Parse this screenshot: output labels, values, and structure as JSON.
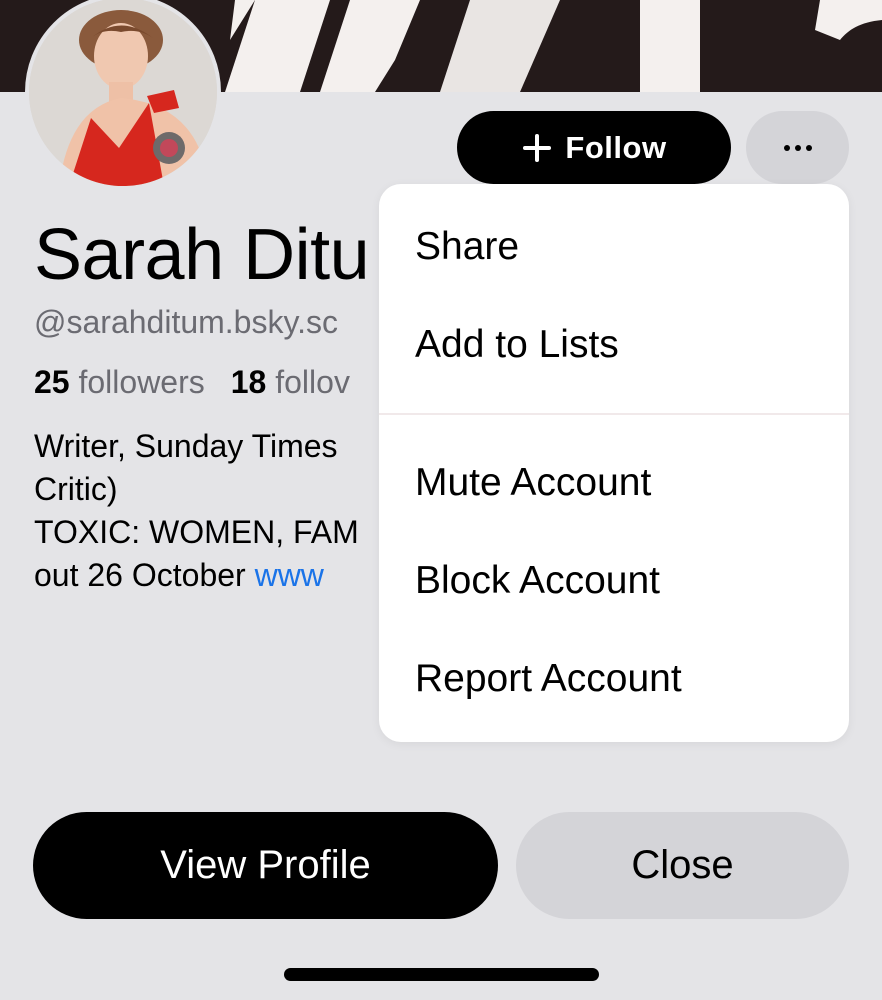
{
  "banner": {
    "image": "book-cover-banner",
    "color": "#241a1a"
  },
  "avatar": {
    "alt": "profile-photo"
  },
  "actions": {
    "follow_label": "Follow",
    "follow_icon": "plus-icon",
    "more_icon": "more-horizontal-icon"
  },
  "profile": {
    "display_name": "Sarah Ditu",
    "handle": "@sarahditum.bsky.sc",
    "followers_count": "25",
    "followers_label": "followers",
    "following_count": "18",
    "following_label": "follov",
    "bio_lines": [
      "Writer, Sunday Times",
      "Critic)",
      "TOXIC: WOMEN, FAM",
      "out 26 October "
    ],
    "bio_link": "www"
  },
  "menu": {
    "items": [
      {
        "label": "Share"
      },
      {
        "label": "Add to Lists"
      },
      {
        "label": "Mute Account"
      },
      {
        "label": "Block Account"
      },
      {
        "label": "Report Account"
      }
    ]
  },
  "footer": {
    "view_profile_label": "View Profile",
    "close_label": "Close"
  },
  "colors": {
    "background": "#e4e4e7",
    "primary_button": "#000000",
    "secondary_button": "#d4d4d8",
    "link": "#1a73e8",
    "muted_text": "#6b6b72"
  }
}
